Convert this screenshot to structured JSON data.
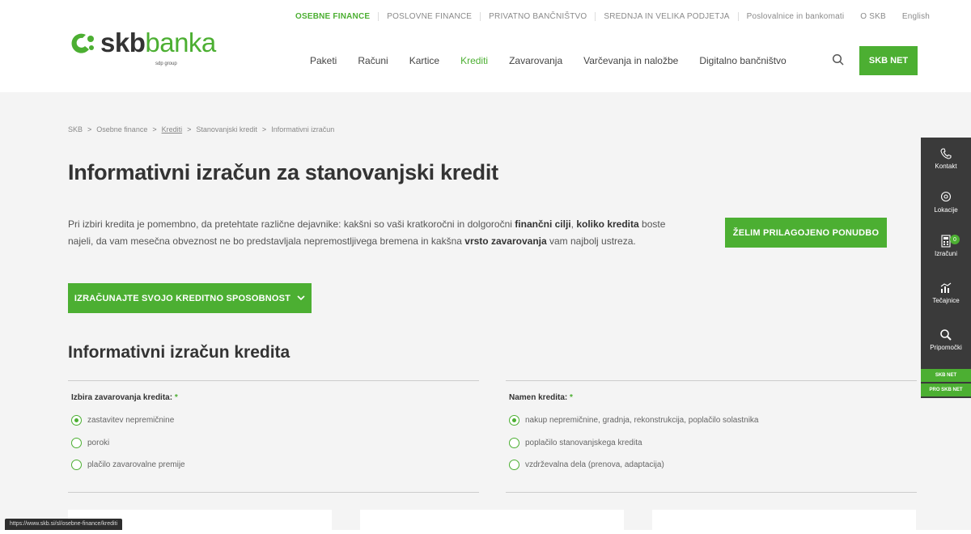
{
  "topnav": [
    "OSEBNE FINANCE",
    "POSLOVNE FINANCE",
    "PRIVATNO BANČNIŠTVO",
    "SREDNJA IN VELIKA PODJETJA",
    "Poslovalnice in bankomati",
    "O SKB",
    "English"
  ],
  "logo": {
    "brand_dark": "skb",
    "brand_light": "banka",
    "sub": "sdp group"
  },
  "mainnav": [
    "Paketi",
    "Računi",
    "Kartice",
    "Krediti",
    "Zavarovanja",
    "Varčevanja in naložbe",
    "Digitalno bančništvo"
  ],
  "skbnet_label": "SKB NET",
  "breadcrumb": [
    "SKB",
    "Osebne finance",
    "Krediti",
    "Stanovanjski kredit",
    "Informativni izračun"
  ],
  "page_title": "Informativni izračun za stanovanjski kredit",
  "intro": {
    "p1": "Pri izbiri kredita je pomembno, da pretehtate različne dejavnike: kakšni so vaši kratkoročni in dolgoročni ",
    "b1": "finančni cilji",
    "p2": ", ",
    "b2": "koliko kredita",
    "p3": " boste najeli, da vam mesečna obveznost ne bo predstavljala nepremostljivega bremena in kakšna ",
    "b3": "vrsto zavarovanja",
    "p4": " vam najbolj ustreza."
  },
  "btn_ponudba": "ŽELIM PRILAGOJENO PONUDBO",
  "btn_izracun": "IZRAČUNAJTE SVOJO KREDITNO SPOSOBNOST",
  "section_title": "Informativni izračun kredita",
  "left": {
    "label": "Izbira zavarovanja kredita:",
    "req": "*",
    "options": [
      "zastavitev nepremičnine",
      "poroki",
      "plačilo zavarovalne premije"
    ]
  },
  "right": {
    "label": "Namen kredita:",
    "req": "*",
    "options": [
      "nakup nepremičnine, gradnja, rekonstrukcija, poplačilo solastnika",
      "poplačilo stanovanjskega kredita",
      "vzdrževalna dela (prenova, adaptacija)"
    ]
  },
  "side": {
    "items": [
      "Kontakt",
      "Lokacije",
      "Izračuni",
      "Tečajnice",
      "Pripomočki"
    ],
    "badge": "0",
    "g1": "SKB NET",
    "g2": "PRO SKB NET"
  },
  "status_url": "https://www.skb.si/sl/osebne-finance/krediti"
}
